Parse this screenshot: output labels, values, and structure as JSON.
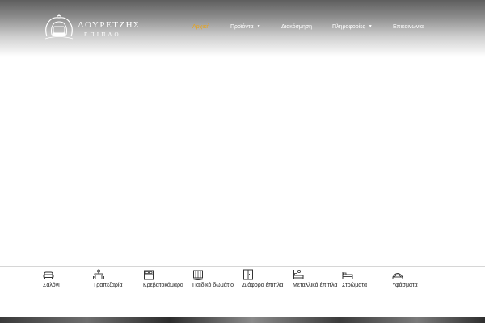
{
  "brand": {
    "name": "ΛΟΥΡΕΤΖΗΣ",
    "subtitle": "ΕΠΙΠΛΟ"
  },
  "nav": {
    "items": [
      {
        "label": "Αρχική",
        "active": true
      },
      {
        "label": "Προϊόντα",
        "has_dropdown": true
      },
      {
        "label": "Διακόσμηση"
      },
      {
        "label": "Πληροφορίες",
        "has_dropdown": true
      },
      {
        "label": "Επικοινωνία"
      }
    ],
    "caret": "▼"
  },
  "categories": {
    "items": [
      {
        "label": "Σαλόνι",
        "icon": "sofa-icon"
      },
      {
        "label": "Τραπεζαρία",
        "icon": "dining-table-icon"
      },
      {
        "label": "Κρεβατοκάμαρα",
        "icon": "bed-icon"
      },
      {
        "label": "Παιδικό δωμάτιο",
        "icon": "crib-icon"
      },
      {
        "label": "Διάφορα έπιπλα",
        "icon": "wardrobe-icon"
      },
      {
        "label": "Μεταλλικά έπιπλα",
        "icon": "metal-bed-icon"
      },
      {
        "label": "Στρώματα",
        "icon": "mattress-bed-icon"
      },
      {
        "label": "Υφάσματα",
        "icon": "fabric-icon"
      }
    ]
  },
  "colors": {
    "active_nav": "#e8a317",
    "nav_text": "#ffffff",
    "category_text": "#222222"
  }
}
